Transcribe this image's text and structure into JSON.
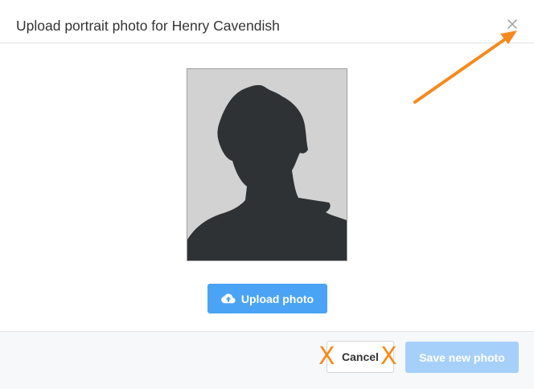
{
  "dialog": {
    "title": "Upload portrait photo for Henry Cavendish",
    "close_icon": "close-icon"
  },
  "portrait": {
    "placeholder_icon": "person-silhouette-icon",
    "background_color": "#d2d2d2",
    "silhouette_color": "#2e3234"
  },
  "upload": {
    "label": "Upload photo",
    "icon": "cloud-upload-icon",
    "color": "#4aa3f5"
  },
  "footer": {
    "cancel_label": "Cancel",
    "save_label": "Save new photo",
    "save_color": "#a6d0fa",
    "save_disabled": true
  },
  "annotations": {
    "arrow_color": "#f48a1d",
    "x_mark": "X"
  }
}
